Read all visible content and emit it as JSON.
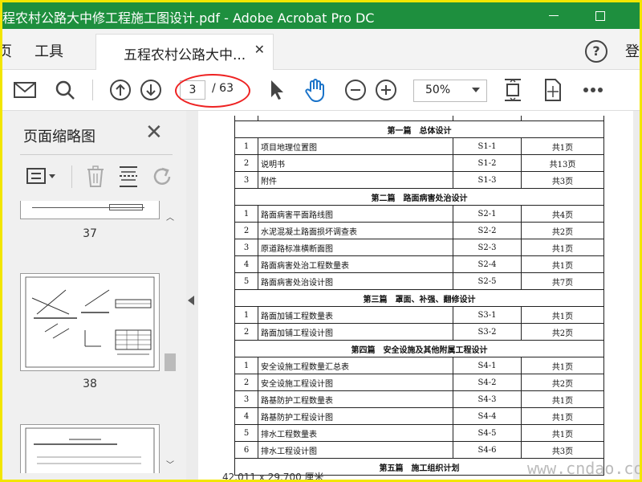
{
  "window": {
    "title": "程农村公路大中修工程施工图设计.pdf - Adobe Acrobat Pro DC"
  },
  "tabbar": {
    "menu_partial": "页",
    "menu_tools": "工具",
    "doc_tab_label": "五程农村公路大中...",
    "help_icon": "?",
    "sign_in_partial": "登"
  },
  "toolbar": {
    "current_page": "3",
    "total_pages": "/ 63",
    "zoom": "50%"
  },
  "side_panel": {
    "title": "页面缩略图",
    "thumbnails": [
      {
        "number": "37"
      },
      {
        "number": "38"
      }
    ]
  },
  "document": {
    "sections": [
      {
        "title": "第一篇　总体设计",
        "rows": [
          {
            "n": "1",
            "name": "项目地理位置图",
            "code": "S1-1",
            "pages": "共1页"
          },
          {
            "n": "2",
            "name": "说明书",
            "code": "S1-2",
            "pages": "共13页"
          },
          {
            "n": "3",
            "name": "附件",
            "code": "S1-3",
            "pages": "共3页"
          }
        ]
      },
      {
        "title": "第二篇　路面病害处治设计",
        "rows": [
          {
            "n": "1",
            "name": "路面病害平面路线图",
            "code": "S2-1",
            "pages": "共4页"
          },
          {
            "n": "2",
            "name": "水泥混凝土路面损坏调查表",
            "code": "S2-2",
            "pages": "共2页"
          },
          {
            "n": "3",
            "name": "原道路标准横断面图",
            "code": "S2-3",
            "pages": "共1页"
          },
          {
            "n": "4",
            "name": "路面病害处治工程数量表",
            "code": "S2-4",
            "pages": "共1页"
          },
          {
            "n": "5",
            "name": "路面病害处治设计图",
            "code": "S2-5",
            "pages": "共7页"
          }
        ]
      },
      {
        "title": "第三篇　罩面、补强、翻修设计",
        "rows": [
          {
            "n": "1",
            "name": "路面加铺工程数量表",
            "code": "S3-1",
            "pages": "共1页"
          },
          {
            "n": "2",
            "name": "路面加铺工程设计图",
            "code": "S3-2",
            "pages": "共2页"
          }
        ]
      },
      {
        "title": "第四篇　安全设施及其他附属工程设计",
        "rows": [
          {
            "n": "1",
            "name": "安全设施工程数量汇总表",
            "code": "S4-1",
            "pages": "共1页"
          },
          {
            "n": "2",
            "name": "安全设施工程设计图",
            "code": "S4-2",
            "pages": "共2页"
          },
          {
            "n": "3",
            "name": "路基防护工程数量表",
            "code": "S4-3",
            "pages": "共1页"
          },
          {
            "n": "4",
            "name": "路基防护工程设计图",
            "code": "S4-4",
            "pages": "共1页"
          },
          {
            "n": "5",
            "name": "排水工程数量表",
            "code": "S4-5",
            "pages": "共1页"
          },
          {
            "n": "6",
            "name": "排水工程设计图",
            "code": "S4-6",
            "pages": "共3页"
          }
        ]
      },
      {
        "title": "第五篇　施工组织计划",
        "rows": []
      }
    ]
  },
  "statusbar": {
    "dimensions": "42.011 x 29.700 厘米"
  },
  "watermark": "www.cndao.com"
}
